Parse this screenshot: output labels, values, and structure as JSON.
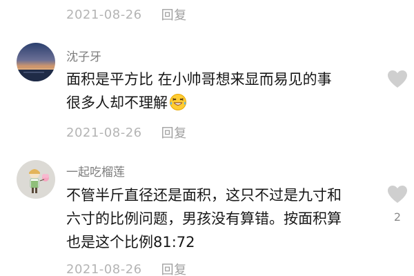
{
  "comments": [
    {
      "date": "2021-08-26",
      "reply_label": "回复"
    },
    {
      "username": "沈子牙",
      "lines": [
        "面积是平方比 在小帅哥想来显而易见的事",
        "很多人却不理解"
      ],
      "emoji": "laughing-crying-emoji",
      "date": "2021-08-26",
      "reply_label": "回复",
      "like_count": ""
    },
    {
      "username": "一起吃榴莲",
      "lines": [
        "不管半斤直径还是面积，这只不过是九寸和",
        "六寸的比例问题，男孩没有算错。按面积算",
        "也是这个比例81:72"
      ],
      "date": "2021-08-26",
      "reply_label": "回复",
      "like_count": "2"
    }
  ],
  "colors": {
    "like_heart": "#cfcfcf",
    "meta_text": "#b4b4b4",
    "username": "#7d7d7d",
    "body_text": "#161616"
  },
  "icons": {
    "like": "heart-icon"
  }
}
